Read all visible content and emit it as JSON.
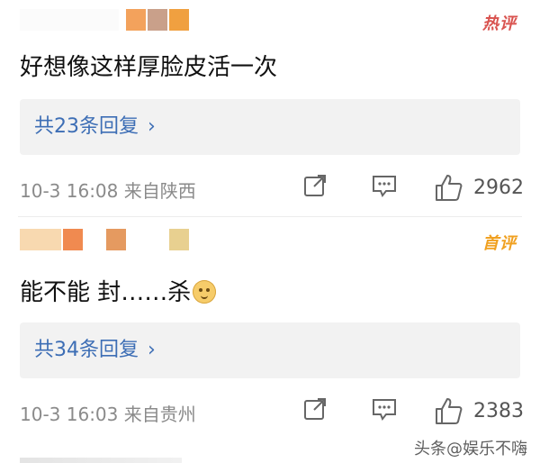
{
  "comments": [
    {
      "tag": "热评",
      "text": "好想像这样厚脸皮活一次",
      "replies": "共23条回复",
      "meta": "10-3 16:08 来自陕西",
      "likes": "2962",
      "name_colors": [
        "#f3a25c",
        "#c9a08a",
        "#f0a040"
      ]
    },
    {
      "tag": "首评",
      "text": "能不能 封……杀",
      "emoji": "doge-emoji",
      "replies": "共34条回复",
      "meta": "10-3 16:03 来自贵州",
      "likes": "2383",
      "name_colors": [
        "#f8d9b0",
        "#f08a50",
        "#e59a60",
        "#e8d090"
      ]
    }
  ],
  "watermark": "头条@娱乐不嗨"
}
